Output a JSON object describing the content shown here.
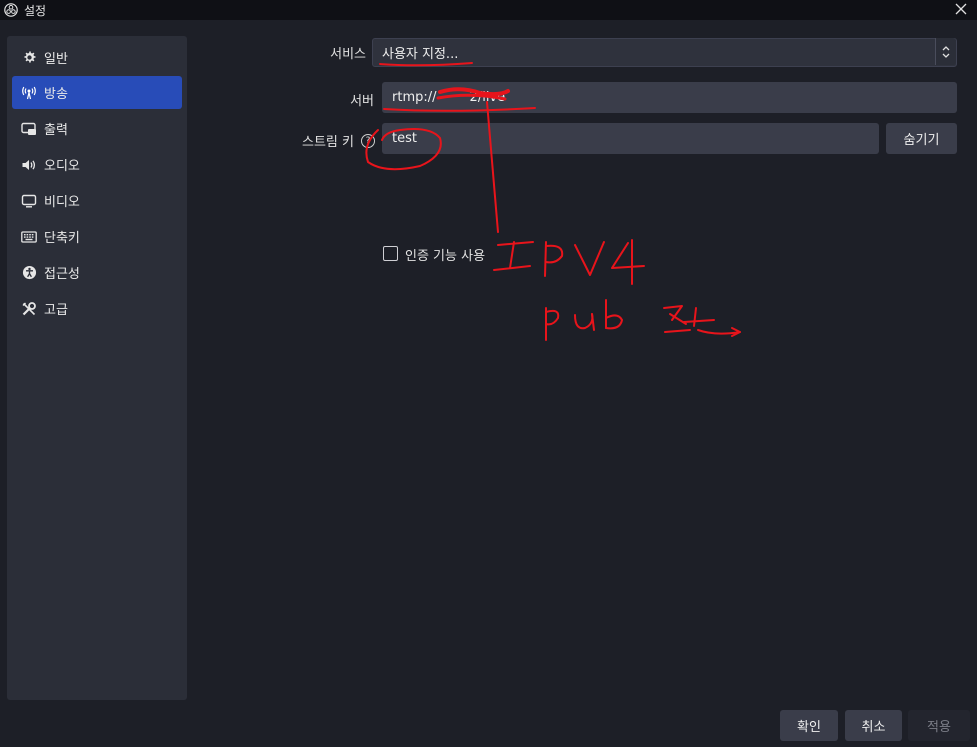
{
  "window": {
    "title": "설정",
    "icons": {
      "logo": "obs-logo-icon",
      "close": "close-icon"
    }
  },
  "sidebar": {
    "items": [
      {
        "label": "일반",
        "icon": "gear-icon",
        "selected": false
      },
      {
        "label": "방송",
        "icon": "broadcast-icon",
        "selected": true
      },
      {
        "label": "출력",
        "icon": "output-icon",
        "selected": false
      },
      {
        "label": "오디오",
        "icon": "speaker-icon",
        "selected": false
      },
      {
        "label": "비디오",
        "icon": "monitor-icon",
        "selected": false
      },
      {
        "label": "단축키",
        "icon": "keyboard-icon",
        "selected": false
      },
      {
        "label": "접근성",
        "icon": "accessibility-icon",
        "selected": false
      },
      {
        "label": "고급",
        "icon": "tools-icon",
        "selected": false
      }
    ]
  },
  "form": {
    "service_label": "서비스",
    "service_value": "사용자 지정...",
    "server_label": "서버",
    "server_value": "rtmp://        2/live",
    "stream_key_label": "스트림 키",
    "stream_key_value": "test",
    "hide_button": "숨기기",
    "auth_label": "인증 기능 사용",
    "auth_checked": false
  },
  "footer": {
    "ok": "확인",
    "cancel": "취소",
    "apply": "적용"
  },
  "colors": {
    "accent": "#284cb8",
    "background": "#1d1f27",
    "panel": "#2b2e38",
    "annotation": "#e8141b"
  }
}
